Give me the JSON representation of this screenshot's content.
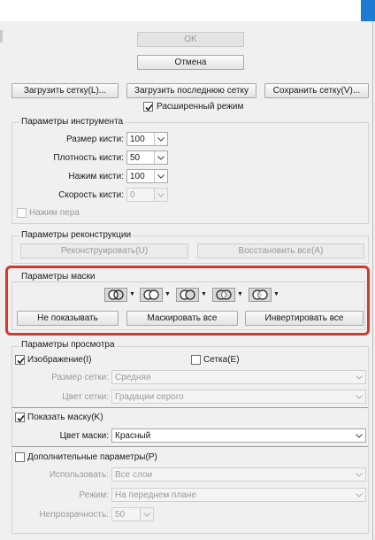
{
  "buttons": {
    "ok": "OK",
    "cancel": "Отмена",
    "load_mesh": "Загрузить сетку(L)...",
    "load_last_mesh": "Загрузить последнюю сетку",
    "save_mesh": "Сохранить сетку(V)..."
  },
  "advanced_mode": {
    "label": "Расширенный режим",
    "checked": true
  },
  "tool_options": {
    "title": "Параметры инструмента",
    "brush_size": {
      "label": "Размер кисти:",
      "value": "100"
    },
    "brush_density": {
      "label": "Плотность кисти:",
      "value": "50"
    },
    "brush_pressure": {
      "label": "Нажим кисти:",
      "value": "100"
    },
    "brush_rate": {
      "label": "Скорость кисти:",
      "value": "0"
    },
    "stylus_pressure": "Нажим пера"
  },
  "reconstruct_options": {
    "title": "Параметры реконструкции",
    "reconstruct": "Реконструировать(U)",
    "restore_all": "Восстановить все(A)"
  },
  "mask_options": {
    "title": "Параметры маски",
    "none": "Не показывать",
    "mask_all": "Маскировать все",
    "invert_all": "Инвертировать все"
  },
  "view_options": {
    "title": "Параметры просмотра",
    "show_image": "Изображение(I)",
    "show_mesh": "Сетка(E)",
    "mesh_size": {
      "label": "Размер сетки:",
      "value": "Средняя"
    },
    "mesh_color": {
      "label": "Цвет сетки:",
      "value": "Градации серого"
    },
    "show_mask": "Показать маску(K)",
    "mask_color": {
      "label": "Цвет маски:",
      "value": "Красный"
    },
    "show_backdrop": "Дополнительные параметры(P)",
    "use": {
      "label": "Использовать:",
      "value": "Все слои"
    },
    "mode": {
      "label": "Режим:",
      "value": "На переднем плане"
    },
    "opacity": {
      "label": "Непрозрачность:",
      "value": "50"
    }
  },
  "colors": {
    "highlight": "#d23a2c",
    "accent": "#1e7bd2"
  }
}
